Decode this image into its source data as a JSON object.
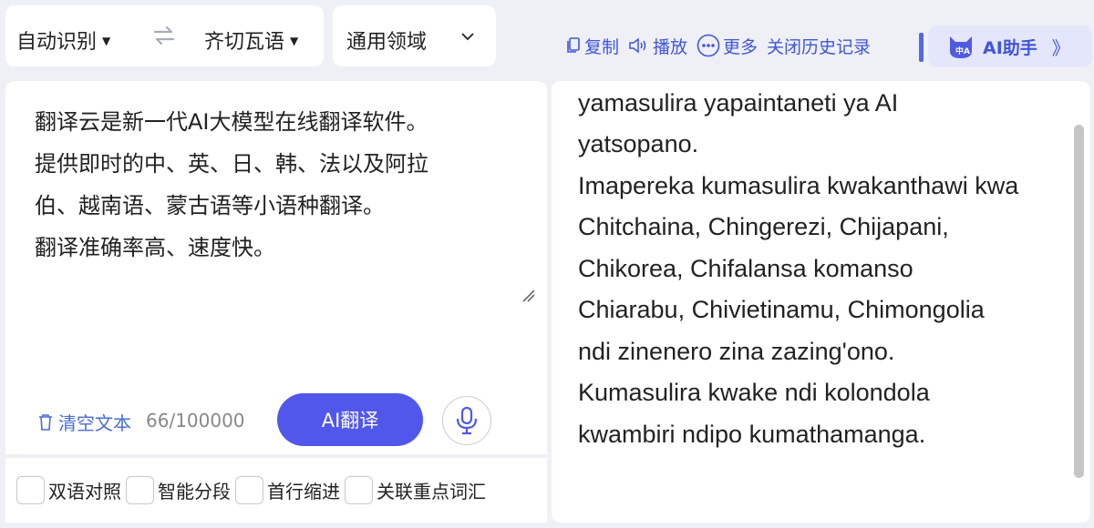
{
  "languages": {
    "source": "自动识别",
    "target": "齐切瓦语",
    "domain": "通用领域"
  },
  "toolbar": {
    "copy": "复制",
    "play": "播放",
    "more": "更多",
    "close_history": "关闭历史记录",
    "ai_assistant": "AI助手",
    "ai_assistant_chevrons": "》"
  },
  "input": {
    "text": "翻译云是新一代AI大模型在线翻译软件。\n提供即时的中、英、日、韩、法以及阿拉\n伯、越南语、蒙古语等小语种翻译。\n翻译准确率高、速度快。",
    "clear_label": "清空文本",
    "counter": "66/100000",
    "translate_button": "AI翻译"
  },
  "options": [
    {
      "label": "双语对照",
      "checked": false
    },
    {
      "label": "智能分段",
      "checked": false
    },
    {
      "label": "首行缩进",
      "checked": false
    },
    {
      "label": "关联重点词汇",
      "checked": false
    }
  ],
  "output": {
    "text": "Translation Cloud ndi pulogalamu\nyamasulira yapaintaneti ya AI\nyatsopano.\nImapereka kumasulira kwakanthawi kwa\nChitchaina, Chingerezi, Chijapani,\nChikorea, Chifalansa komanso\nChiarabu, Chivietinamu, Chimongolia\nndi zinenero zina zazing'ono.\nKumasulira kwake ndi kolondola\nkwambiri ndipo kumathamanga."
  },
  "colors": {
    "accent": "#4055d8",
    "button": "#5157ea",
    "background": "#eef0f6"
  }
}
